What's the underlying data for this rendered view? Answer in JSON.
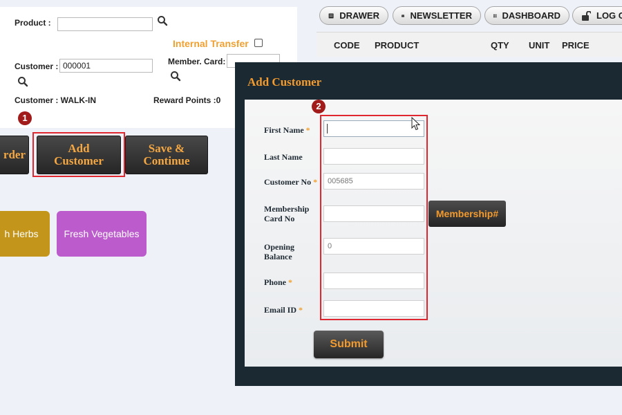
{
  "colors": {
    "accent": "#f29a2e",
    "danger_badge": "#a21b1b",
    "highlight": "#e0262e",
    "modal_bg": "#1b2a32"
  },
  "left_form": {
    "product_label": "Product :",
    "product_value": "",
    "internal_transfer_label": "Internal Transfer",
    "customer_label": "Customer :",
    "customer_value": "000001",
    "member_card_label": "Member. Card:",
    "member_card_value": "",
    "customer_name_text": "Customer : WALK-IN",
    "reward_points_text": "Reward Points :0",
    "step_badge_1": "1"
  },
  "action_buttons": {
    "order_partial": "rder",
    "add_customer": "Add Customer",
    "save_continue": "Save & Continue"
  },
  "category_tiles": [
    {
      "label": "h Herbs",
      "color": "#c4951b"
    },
    {
      "label": "Fresh Vegetables",
      "color": "#bb5bcc"
    }
  ],
  "top_nav": [
    {
      "label": "DRAWER",
      "icon": "drawer-icon"
    },
    {
      "label": "NEWSLETTER",
      "icon": "envelope-icon"
    },
    {
      "label": "DASHBOARD",
      "icon": "dashboard-icon"
    },
    {
      "label": "LOG O",
      "icon": "unlock-icon"
    }
  ],
  "table": {
    "headers": [
      "CODE",
      "PRODUCT",
      "QTY",
      "UNIT",
      "PRICE"
    ]
  },
  "modal": {
    "title": "Add Customer",
    "step_badge_2": "2",
    "fields": [
      {
        "label": "First Name",
        "required": "*",
        "value": "",
        "placeholder": ""
      },
      {
        "label": "Last Name",
        "required": "",
        "value": "",
        "placeholder": ""
      },
      {
        "label": "Customer No",
        "required": "*",
        "value": "005685",
        "placeholder": ""
      },
      {
        "label": "Membership Card No",
        "required": "",
        "value": "",
        "placeholder": ""
      },
      {
        "label": "Opening Balance",
        "required": "",
        "value": "0",
        "placeholder": ""
      },
      {
        "label": "Phone",
        "required": "*",
        "value": "",
        "placeholder": ""
      },
      {
        "label": "Email ID",
        "required": "*",
        "value": "",
        "placeholder": ""
      }
    ],
    "membership_button": "Membership#",
    "submit_label": "Submit"
  }
}
